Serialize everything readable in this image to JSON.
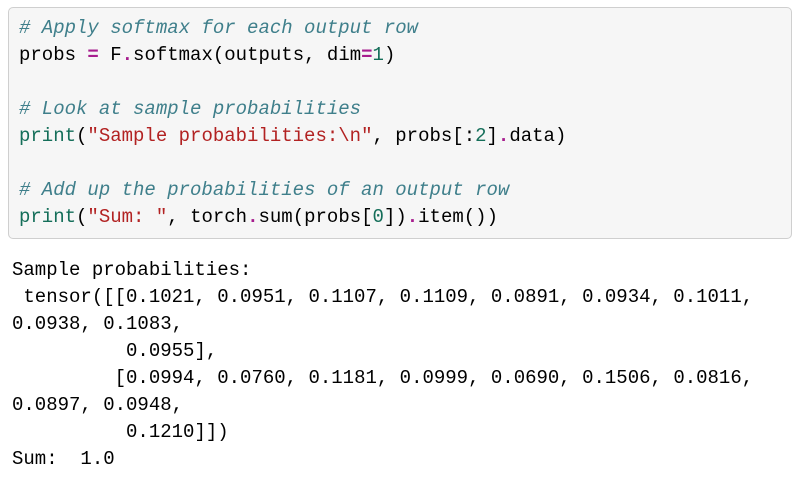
{
  "code": {
    "c1": "# Apply softmax for each output row",
    "l2_a": "probs ",
    "l2_eq": "=",
    "l2_b": " F",
    "l2_dot1": ".",
    "l2_soft": "softmax",
    "l2_p1": "(",
    "l2_out": "outputs",
    "l2_comma": ", ",
    "l2_dim": "dim",
    "l2_eq2": "=",
    "l2_one": "1",
    "l2_p2": ")",
    "c2": "# Look at sample probabilities",
    "l5_print": "print",
    "l5_p1": "(",
    "l5_str": "\"Sample probabilities:\\n\"",
    "l5_comma": ", ",
    "l5_probs": "probs",
    "l5_br1": "[:",
    "l5_two": "2",
    "l5_br2": "]",
    "l5_dot": ".",
    "l5_data": "data",
    "l5_p2": ")",
    "c3": "# Add up the probabilities of an output row",
    "l8_print": "print",
    "l8_p1": "(",
    "l8_str": "\"Sum: \"",
    "l8_comma": ", ",
    "l8_torch": "torch",
    "l8_dot1": ".",
    "l8_sum": "sum",
    "l8_p2": "(",
    "l8_probs": "probs",
    "l8_br1": "[",
    "l8_zero": "0",
    "l8_br2": "])",
    "l8_dot2": ".",
    "l8_item": "item",
    "l8_p3": "())"
  },
  "output": {
    "line1": "Sample probabilities:",
    "line2": " tensor([[0.1021, 0.0951, 0.1107, 0.1109, 0.0891, 0.0934, 0.1011, 0.0938, 0.1083,",
    "line3": "          0.0955],",
    "line4": "         [0.0994, 0.0760, 0.1181, 0.0999, 0.0690, 0.1506, 0.0816, 0.0897, 0.0948,",
    "line5": "          0.1210]])",
    "line6": "Sum:  1.0"
  }
}
